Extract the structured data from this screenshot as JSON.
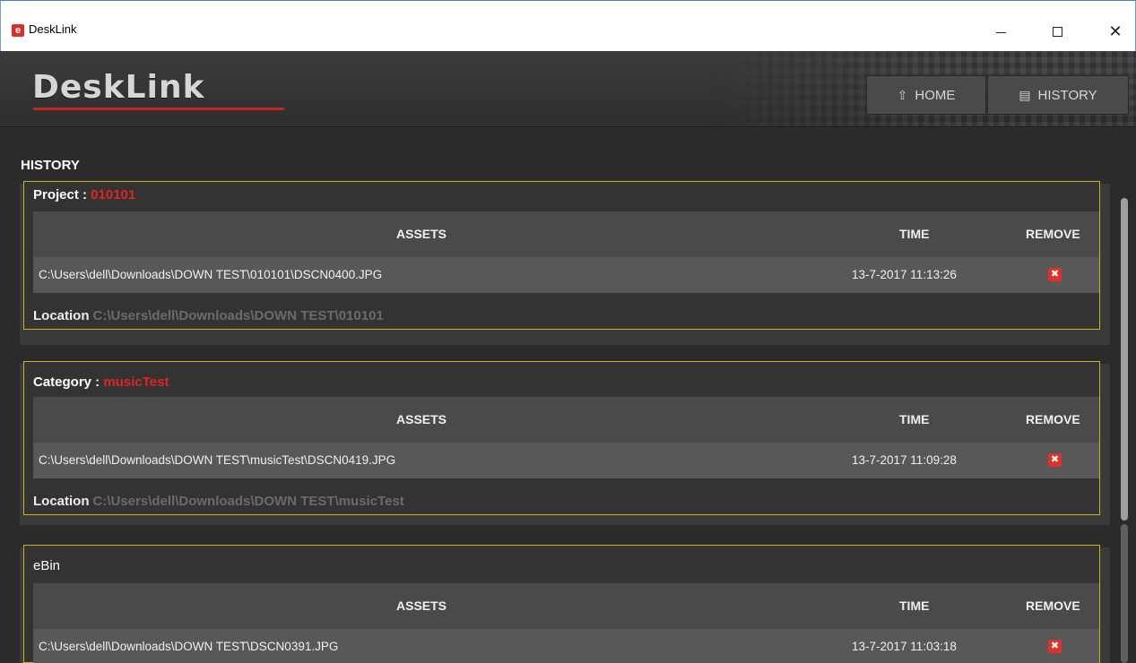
{
  "window": {
    "title": "DeskLink",
    "app_icon_glyph": "e"
  },
  "header": {
    "logo": "DeskLink",
    "nav": {
      "home_label": "HOME",
      "history_label": "HISTORY"
    }
  },
  "page": {
    "title": "HISTORY"
  },
  "colors": {
    "accent_red": "#e02424",
    "card_border": "#c8b41e",
    "logo_underline": "#c42525"
  },
  "cards": [
    {
      "label": "Project : ",
      "value": "010101",
      "columns": {
        "assets": "ASSETS",
        "time": "TIME",
        "remove": "REMOVE"
      },
      "rows": [
        {
          "asset": "C:\\Users\\dell\\Downloads\\DOWN TEST\\010101\\DSCN0400.JPG",
          "time": "13-7-2017 11:13:26"
        }
      ],
      "location_label": "Location",
      "location_path": "C:\\Users\\dell\\Downloads\\DOWN TEST\\010101"
    },
    {
      "label": "Category : ",
      "value": "musicTest",
      "columns": {
        "assets": "ASSETS",
        "time": "TIME",
        "remove": "REMOVE"
      },
      "rows": [
        {
          "asset": "C:\\Users\\dell\\Downloads\\DOWN TEST\\musicTest\\DSCN0419.JPG",
          "time": "13-7-2017 11:09:28"
        }
      ],
      "location_label": "Location",
      "location_path": "C:\\Users\\dell\\Downloads\\DOWN TEST\\musicTest"
    },
    {
      "label": "eBin",
      "value": "",
      "columns": {
        "assets": "ASSETS",
        "time": "TIME",
        "remove": "REMOVE"
      },
      "rows": [
        {
          "asset": "C:\\Users\\dell\\Downloads\\DOWN TEST\\DSCN0391.JPG",
          "time": "13-7-2017 11:03:18"
        }
      ]
    }
  ]
}
